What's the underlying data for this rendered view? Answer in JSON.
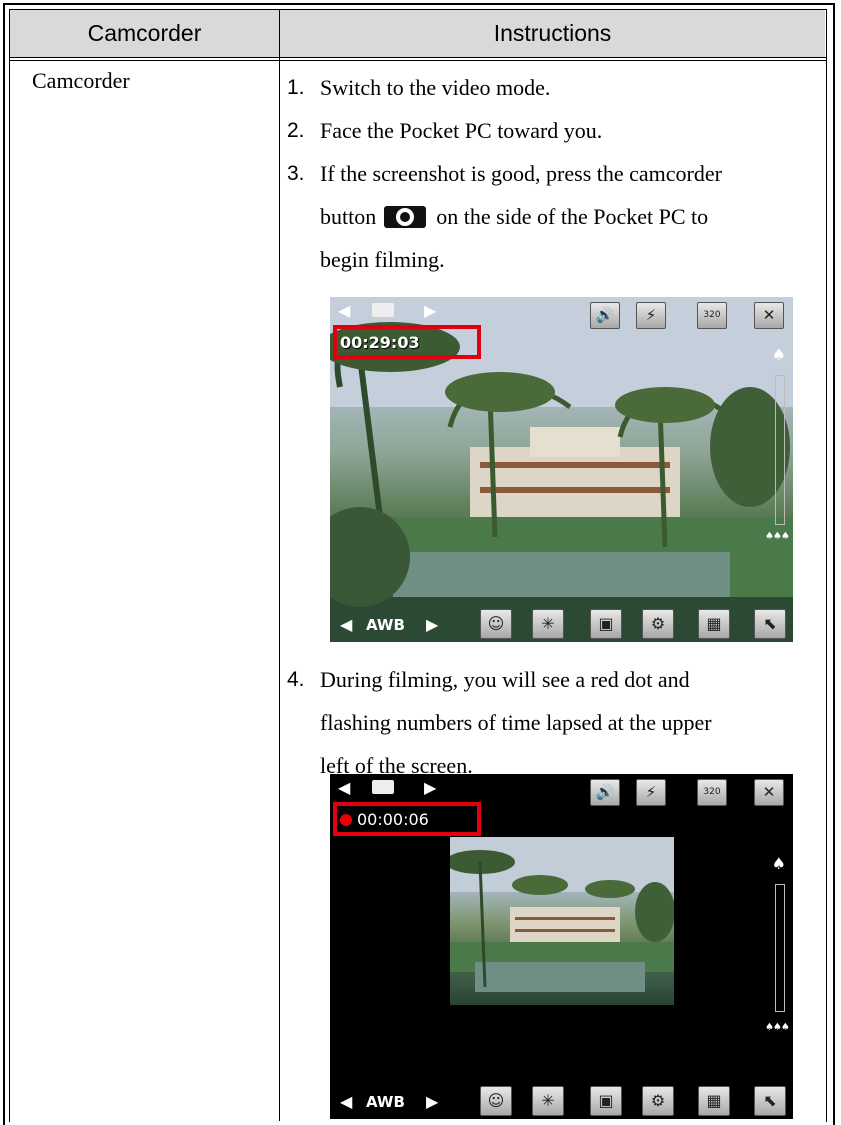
{
  "table": {
    "headers": [
      "Camcorder",
      "Instructions"
    ],
    "row_label": "Camcorder",
    "steps": [
      {
        "num": "1.",
        "text": "Switch to the video mode."
      },
      {
        "num": "2.",
        "text": "Face the Pocket PC toward you."
      },
      {
        "num": "3.",
        "text_a": "If the screenshot is good, press the camcorder",
        "text_b": "button",
        "text_c": "on the side of the Pocket PC to",
        "text_d": "begin filming."
      },
      {
        "num": "4.",
        "text_a": "During filming, you will see a red dot and",
        "text_b": "flashing numbers of time lapsed at the upper",
        "text_c": "left of the screen."
      }
    ]
  },
  "screenshot1": {
    "timer": "00:29:03",
    "resolution_badge": "320",
    "white_balance": "AWB"
  },
  "screenshot2": {
    "timer": "00:00:06",
    "resolution_badge": "320",
    "white_balance": "AWB"
  },
  "colors": {
    "header_bg": "#d9d9d9",
    "highlight": "#e00010",
    "record_dot": "#e00000"
  }
}
